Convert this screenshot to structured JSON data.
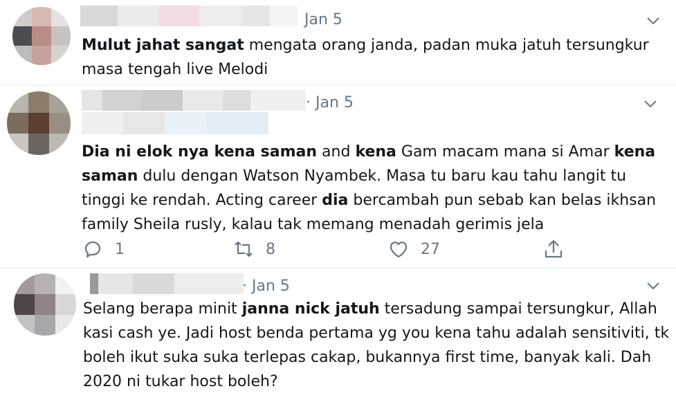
{
  "tweets": [
    {
      "date": "Jan 5",
      "lines": [
        [
          {
            "t": "Mulut jahat sangat",
            "b": true
          },
          {
            "t": " mengata orang janda, padan muka jatuh tersungkur",
            "b": false
          }
        ],
        [
          {
            "t": "masa tengah live Melodi",
            "b": false
          }
        ]
      ]
    },
    {
      "date": "· Jan 5",
      "lines": [
        [
          {
            "t": "Dia ni elok nya kena saman",
            "b": true
          },
          {
            "t": " and ",
            "b": false
          },
          {
            "t": "kena",
            "b": true
          },
          {
            "t": " Gam macam mana si Amar ",
            "b": false
          },
          {
            "t": "kena",
            "b": true
          }
        ],
        [
          {
            "t": "saman",
            "b": true
          },
          {
            "t": " dulu dengan Watson Nyambek. Masa tu baru kau tahu langit tu",
            "b": false
          }
        ],
        [
          {
            "t": "tinggi ke rendah. Acting career ",
            "b": false
          },
          {
            "t": "dia",
            "b": true
          },
          {
            "t": " bercambah pun sebab kan belas ikhsan",
            "b": false
          }
        ],
        [
          {
            "t": "family Sheila rusly, kalau tak memang menadah gerimis jela",
            "b": false
          }
        ]
      ],
      "actions": {
        "reply_count": "1",
        "retweet_count": "8",
        "like_count": "27"
      }
    },
    {
      "date": "· Jan 5",
      "lines": [
        [
          {
            "t": "Selang berapa minit ",
            "b": false
          },
          {
            "t": "janna nick jatuh",
            "b": true
          },
          {
            "t": " tersadung sampai tersungkur, Allah",
            "b": false
          }
        ],
        [
          {
            "t": "kasi cash ye. Jadi host benda pertama yg you kena tahu adalah sensitiviti, tk",
            "b": false
          }
        ],
        [
          {
            "t": "boleh ikut suka suka terlepas cakap, bukannya first time, banyak kali. Dah",
            "b": false
          }
        ],
        [
          {
            "t": "2020 ni tukar host boleh?",
            "b": false
          }
        ]
      ]
    }
  ],
  "icons": {
    "more": "chevron-down-icon",
    "reply": "reply-icon",
    "retweet": "retweet-icon",
    "like": "heart-icon",
    "share": "share-icon"
  },
  "colors": {
    "text": "#14171a",
    "muted": "#657786",
    "divider": "#e6ecf0"
  }
}
